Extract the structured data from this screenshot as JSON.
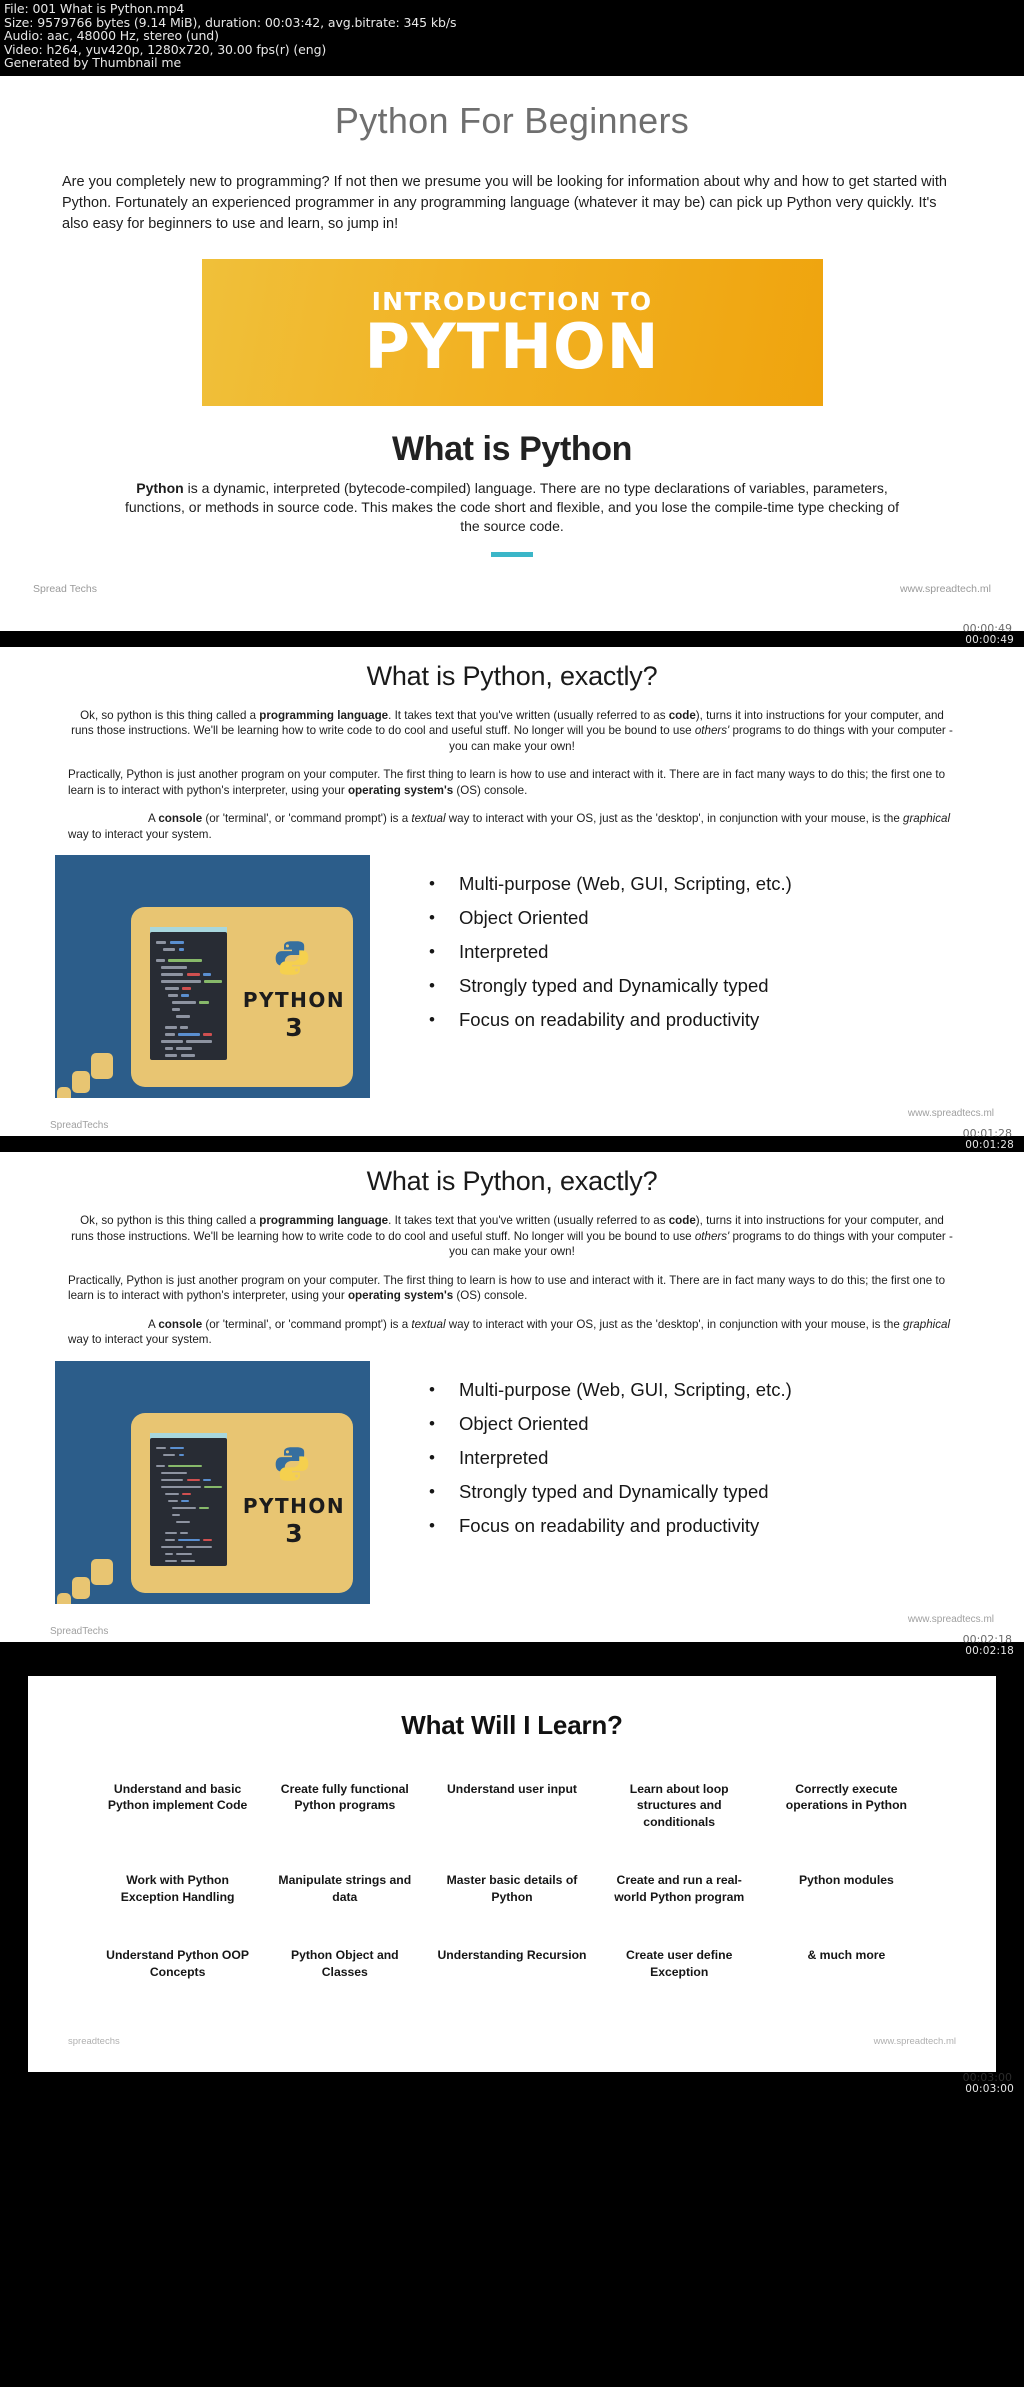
{
  "meta": {
    "lines": [
      "File: 001 What is Python.mp4",
      "Size: 9579766 bytes (9.14 MiB), duration: 00:03:42, avg.bitrate: 345 kb/s",
      "Audio: aac, 48000 Hz, stereo (und)",
      "Video: h264, yuv420p, 1280x720, 30.00 fps(r) (eng)",
      "Generated by Thumbnail me"
    ]
  },
  "colors": {
    "banner_start": "#f0c03a",
    "banner_end": "#efa40e",
    "accent_bar": "#3bb6c8",
    "art_background": "#2c5d8a",
    "art_card": "#e8c572"
  },
  "slide1": {
    "title": "Python For Beginners",
    "intro": "Are you  completely new to programming? If not then we presume you will be looking for information about why and how to get started with Python. Fortunately an experienced programmer in any programming language (whatever it may be) can pick up Python very quickly. It's also easy for beginners to use and learn, so jump in!",
    "banner_line1": "INTRODUCTION TO",
    "banner_line2": "PYTHON",
    "heading": "What is Python",
    "body": "Python is a dynamic, interpreted (bytecode-compiled) language. There are no type declarations of variables, parameters, functions, or methods in source code. This makes the code short and flexible, and you lose the compile-time type checking of the source code.",
    "body_lead": "Python",
    "footer_left": "Spread Techs",
    "footer_right": "www.spreadtech.ml",
    "timestamp": "00:00:49"
  },
  "slide2": {
    "title": "What is Python, exactly?",
    "para1_a": "Ok, so python is this thing called a ",
    "para1_b": "programming language",
    "para1_c": ". It takes text that you've written (usually referred to as ",
    "para1_d": "code",
    "para1_e": "), turns it into instructions for your computer, and runs those instructions. We'll be learning how to write code to do cool and useful stuff. No longer will you be bound to use ",
    "para1_f": "others'",
    "para1_g": " programs to do things with your computer - you can make your own!",
    "para2_a": "Practically, Python is just another program on your computer. The first thing to learn is how to use and interact with it. There are in fact many ways to do this; the first one to learn is to interact with python's interpreter, using your ",
    "para2_b": "operating system's",
    "para2_c": " (OS) console.",
    "para3_a": "A ",
    "para3_b": "console",
    "para3_c": " (or 'terminal', or 'command prompt') is a ",
    "para3_d": "textual",
    "para3_e": " way to interact with your OS, just as the 'desktop', in conjunction with your mouse, is the ",
    "para3_f": "graphical",
    "para3_g": " way to interact your system.",
    "art_label": "PYTHON",
    "art_version": "3",
    "bullets": [
      "Multi-purpose (Web, GUI, Scripting, etc.)",
      "Object Oriented",
      "Interpreted",
      "Strongly typed and Dynamically typed",
      "Focus on readability and productivity"
    ],
    "footer_left": "SpreadTechs",
    "footer_right": "www.spreadtecs.ml",
    "timestamp": "00:01:28"
  },
  "slide3": {
    "timestamp": "00:02:18"
  },
  "slide4": {
    "title": "What Will I Learn?",
    "items": [
      "Understand and basic Python implement Code",
      "Create fully functional Python programs",
      "Understand user input",
      "Learn about loop structures and conditionals",
      "Correctly execute operations in Python",
      "Work with Python Exception Handling",
      "Manipulate strings and data",
      "Master basic details of Python",
      "Create and run a real-world Python program",
      "Python modules",
      "Understand Python OOP Concepts",
      "Python Object and Classes",
      "Understanding Recursion",
      "Create user define Exception",
      "& much more"
    ],
    "footer_left": "spreadtechs",
    "footer_right": "www.spreadtech.ml",
    "timestamp": "00:03:00"
  }
}
